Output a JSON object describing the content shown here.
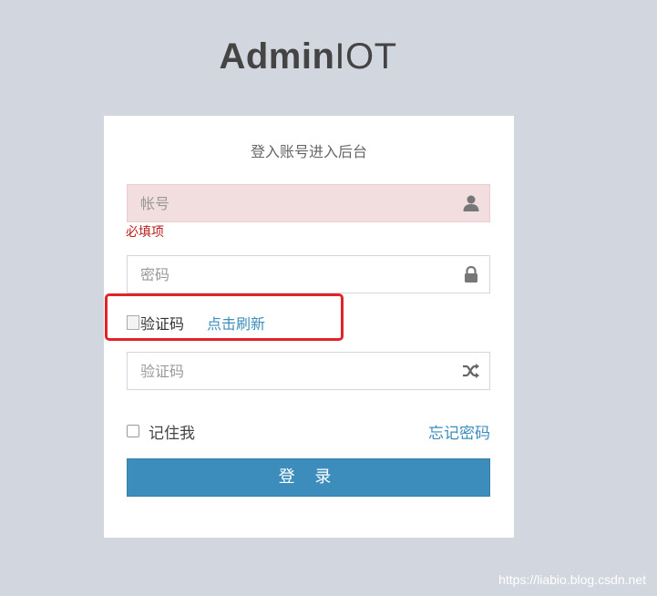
{
  "logo": {
    "bold": "Admin",
    "light": "IOT"
  },
  "box_msg": "登入账号进入后台",
  "account": {
    "placeholder": "帐号",
    "value": "",
    "icon": "user-icon",
    "error": "必填项"
  },
  "password": {
    "placeholder": "密码",
    "value": "",
    "icon": "lock-icon"
  },
  "captcha": {
    "image_alt": "验证码",
    "refresh": "点击刷新"
  },
  "captcha_input": {
    "placeholder": "验证码",
    "value": "",
    "icon": "random-icon"
  },
  "remember_label": "记住我",
  "forgot_label": "忘记密码",
  "login_label": "登 录",
  "watermark": "https://liabio.blog.csdn.net",
  "colors": {
    "accent": "#3c8dbc",
    "error": "#b91d1d",
    "error_bg": "#f2dede",
    "highlight": "#e0242a"
  }
}
